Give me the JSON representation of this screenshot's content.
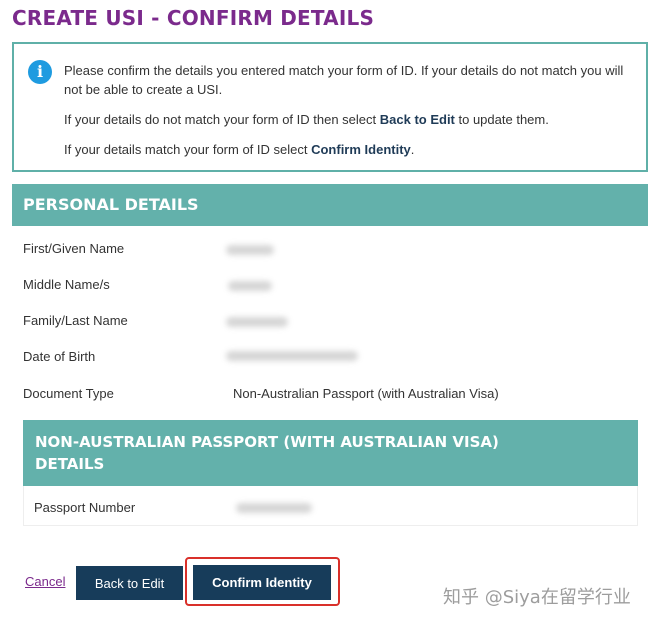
{
  "page": {
    "title": "CREATE USI - CONFIRM DETAILS"
  },
  "info": {
    "icon": "info-icon",
    "icon_glyph": "i",
    "line1": "Please confirm the details you entered match your form of ID. If your details do not match you will not be able to create a USI.",
    "line2_prefix": "If your details do not match your form of ID then select ",
    "line2_bold": "Back to Edit",
    "line2_suffix": " to update them.",
    "line3_prefix": "If your details match your form of ID select ",
    "line3_bold": "Confirm Identity",
    "line3_suffix": "."
  },
  "personal": {
    "header": "PERSONAL DETAILS",
    "fields": [
      {
        "label": "First/Given Name",
        "value": ""
      },
      {
        "label": "Middle Name/s",
        "value": ""
      },
      {
        "label": "Family/Last Name",
        "value": ""
      },
      {
        "label": "Date of Birth",
        "value": ""
      },
      {
        "label": "Document Type",
        "value": "Non-Australian Passport (with Australian Visa)"
      }
    ]
  },
  "passport": {
    "header_line1": "NON-AUSTRALIAN PASSPORT (WITH AUSTRALIAN VISA)",
    "header_line2": "DETAILS",
    "fields": [
      {
        "label": "Passport Number",
        "value": ""
      }
    ]
  },
  "actions": {
    "cancel_label": "Cancel",
    "back_label": "Back to Edit",
    "confirm_label": "Confirm Identity"
  },
  "watermark": {
    "text": "知乎 @Siya在留学行业"
  },
  "colors": {
    "title": "#7b2a8c",
    "accent_teal": "#63b1ab",
    "button_navy": "#173c5a",
    "highlight_red": "#d9302a",
    "info_blue": "#1e9be0"
  }
}
